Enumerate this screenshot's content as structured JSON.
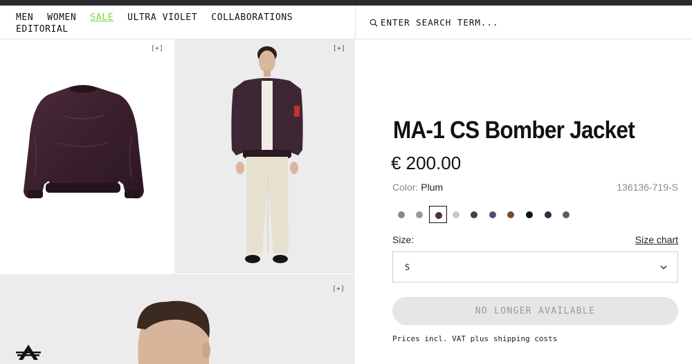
{
  "nav": {
    "items": [
      "MEN",
      "WOMEN",
      "SALE",
      "ULTRA VIOLET",
      "COLLABORATIONS"
    ],
    "second_row": "EDITORIAL",
    "sale_color": "#7fd43a"
  },
  "search": {
    "placeholder": "ENTER SEARCH TERM...",
    "icon": "search-icon"
  },
  "gallery": {
    "zoom_label": "[+]"
  },
  "product": {
    "title": "MA-1 CS Bomber Jacket",
    "price": "€ 200.00",
    "color_label": "Color:",
    "color_value": "Plum",
    "sku": "136136-719-S",
    "swatches": [
      {
        "color": "#8a8a80",
        "selected": false
      },
      {
        "color": "#9d968c",
        "selected": false
      },
      {
        "color": "#4a2f3c",
        "selected": true
      },
      {
        "color": "#c8c8c8",
        "selected": false
      },
      {
        "color": "#3f434a",
        "selected": false
      },
      {
        "color": "#46507a",
        "selected": false
      },
      {
        "color": "#7a4a30",
        "selected": false
      },
      {
        "color": "#111111",
        "selected": false
      },
      {
        "color": "#2a3040",
        "selected": false
      },
      {
        "color": "#5a5c5e",
        "selected": false
      }
    ],
    "size_label": "Size:",
    "size_chart": "Size chart",
    "size_value": "S",
    "button_label": "NO LONGER AVAILABLE",
    "vat_note": "Prices incl. VAT plus shipping costs"
  }
}
